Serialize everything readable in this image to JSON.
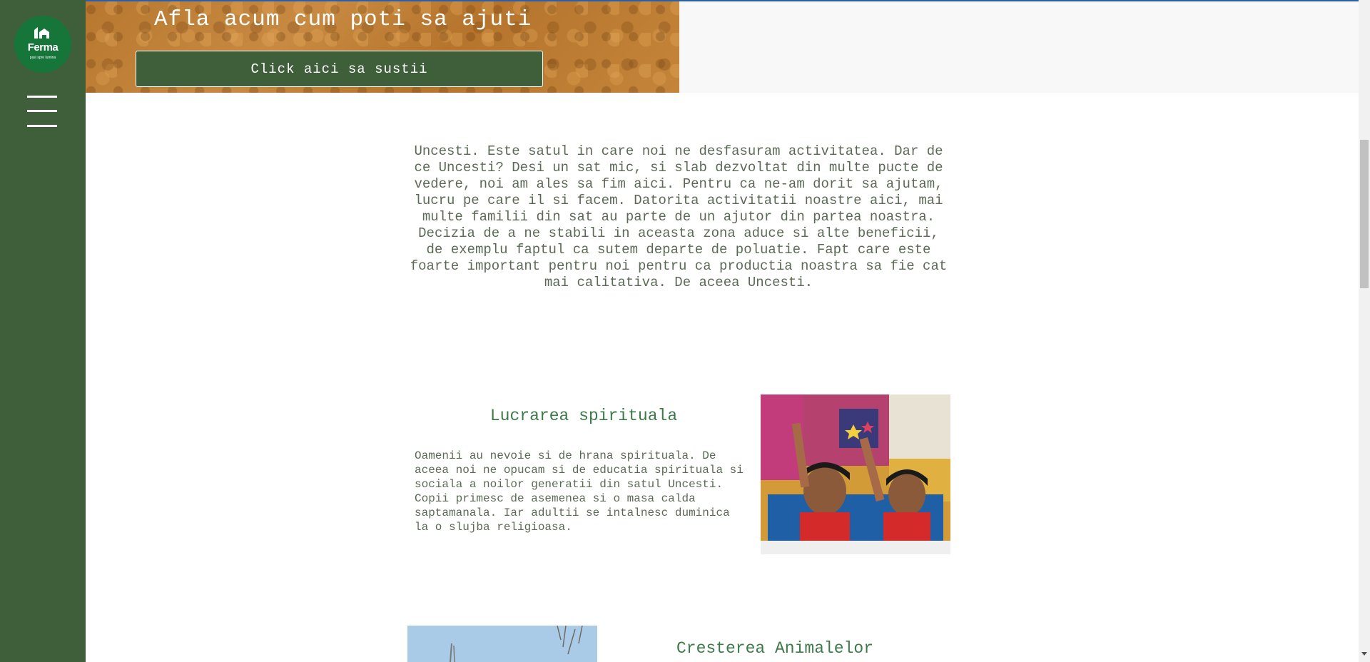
{
  "sidebar": {
    "logo": {
      "name": "Ferma",
      "tagline": "pasi spre lumina"
    },
    "menu_icon": "hamburger-icon"
  },
  "banner": {
    "title": "Afla acum cum poti sa ajuti",
    "button_label": "Click aici sa sustii"
  },
  "intro": {
    "text": "Uncesti. Este satul in care noi ne desfasuram activitatea. Dar de ce Uncesti? Desi un sat mic, si slab dezvoltat din multe pucte de vedere, noi am ales sa fim aici. Pentru ca ne-am dorit sa ajutam, lucru pe care il si facem. Datorita activitatii noastre aici, mai multe familii din sat au parte de un ajutor din partea noastra. Decizia de a ne stabili in aceasta zona aduce si alte beneficii, de exemplu faptul ca sutem departe de poluatie. Fapt care este foarte important pentru noi pentru ca productia noastra sa fie cat mai calitativa. De aceea Uncesti."
  },
  "sections": [
    {
      "title": "Lucrarea spirituala",
      "text": "Oamenii au nevoie si de hrana spirituala. De aceea noi ne opucam si de educatia spirituala si sociala a noilor generatii din satul Uncesti. Copii primesc de asemenea si o masa calda saptamanala. Iar adultii se intalnesc duminica la o slujba religioasa."
    },
    {
      "title": "Cresterea Animalelor"
    }
  ],
  "colors": {
    "sidebar": "#3e5f3a",
    "logo_bg": "#16763a",
    "heading": "#3d7a4a",
    "body_text": "#5b6a56"
  }
}
